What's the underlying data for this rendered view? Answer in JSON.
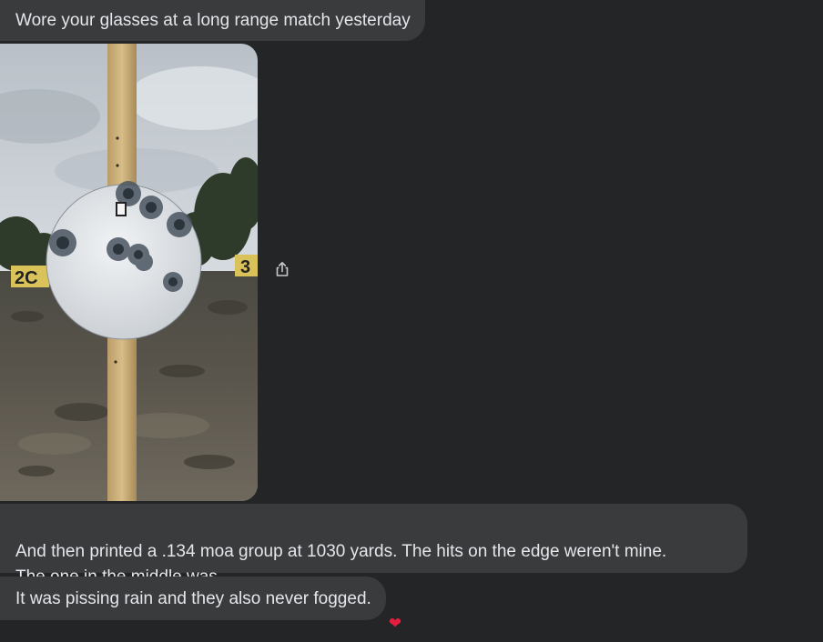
{
  "messages": {
    "first": "Wore your glasses at a long range match yesterday",
    "second": "And then printed a .134 moa group at 1030 yards. The hits on the edge weren't mine.\nThe one in the middle was.",
    "third": "It was pissing rain and they also never fogged."
  },
  "reaction": {
    "emoji": "❤"
  },
  "photo": {
    "sign_left": "2C",
    "sign_right": "3"
  },
  "icons": {
    "share": "share-icon",
    "reaction": "heart-icon"
  },
  "colors": {
    "background": "#242526",
    "bubble": "#3a3b3c",
    "text": "#e4e6eb",
    "heart": "#e41e3f"
  }
}
